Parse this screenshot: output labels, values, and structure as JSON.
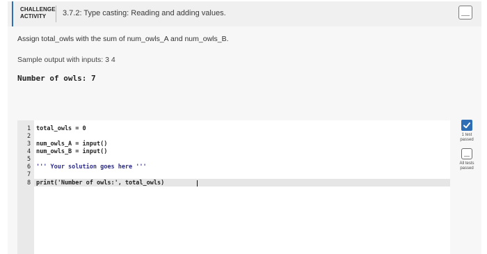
{
  "header": {
    "label_line1": "CHALLENGE",
    "label_line2": "ACTIVITY",
    "title": "3.7.2: Type casting: Reading and adding values."
  },
  "instructions": "Assign total_owls with the sum of num_owls_A and num_owls_B.",
  "sample": {
    "label": "Sample output with inputs: 3 4",
    "output": "Number of owls: 7"
  },
  "editor": {
    "line_numbers": [
      "1",
      "2",
      "3",
      "4",
      "5",
      "6",
      "7",
      "8"
    ],
    "lines": [
      "total_owls = 0",
      "",
      "num_owls_A = input()",
      "num_owls_B = input()",
      "",
      "''' Your solution goes here '''",
      "",
      "print('Number of owls:', total_owls)"
    ]
  },
  "tests": {
    "first_status_line1": "1 test",
    "first_status_line2": "passed",
    "all_status_line1": "All tests",
    "all_status_line2": "passed"
  },
  "colors": {
    "accent": "#2e6eb5"
  },
  "icons": {
    "header_box": "checkbox-outline-icon",
    "test1": "checkmark-icon",
    "test_all": "checkbox-outline-icon"
  }
}
